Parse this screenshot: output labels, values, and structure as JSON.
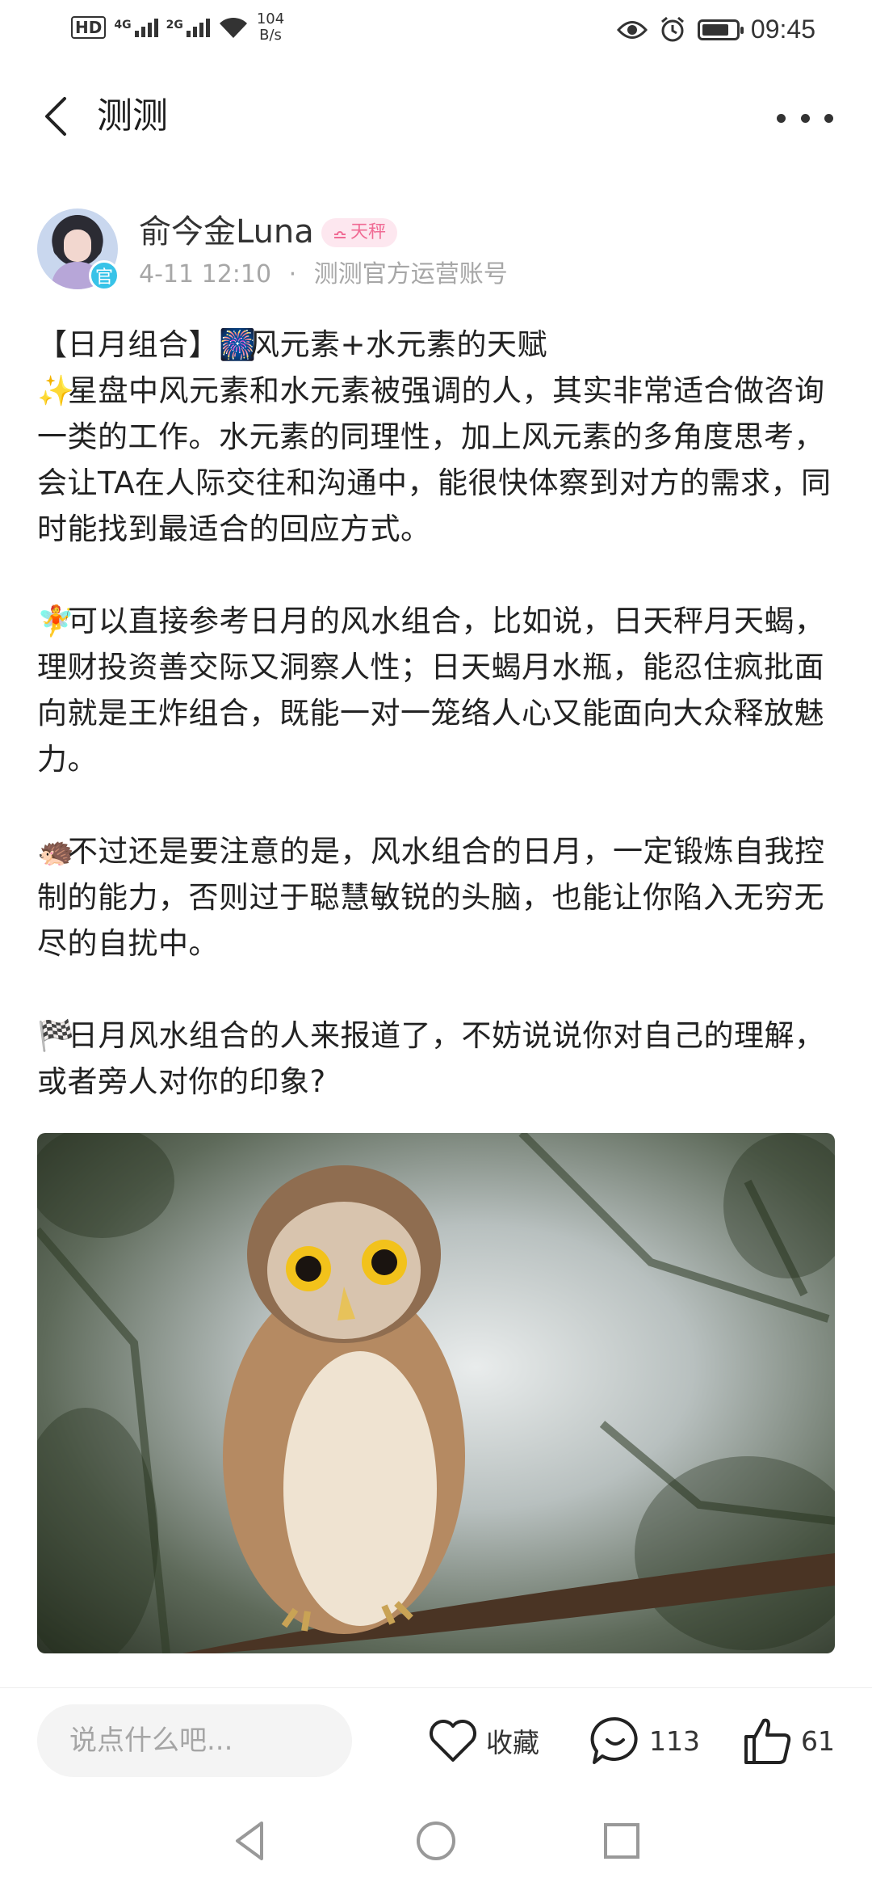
{
  "status_bar": {
    "left": {
      "hd": "HD",
      "sim1": "4G",
      "sim2": "2G",
      "speed_value": "104",
      "speed_unit": "B/s"
    },
    "time": "09:45",
    "battery_level_percent": 80
  },
  "nav": {
    "title": "测测",
    "back_icon": "chevron-left-icon",
    "more_icon": "more-dots-icon"
  },
  "author": {
    "name": "俞今金Luna",
    "official_badge": "官",
    "zodiac_tag": "天秤",
    "zodiac_icon": "libra-icon",
    "time": "4-11 12:10",
    "separator": "·",
    "account_desc": "测测官方运营账号"
  },
  "post": {
    "title": {
      "prefix": "【日月组合】",
      "emoji": "🎆",
      "text": "风元素+水元素的天赋"
    },
    "p1": {
      "emoji": "✨",
      "text": "星盘中风元素和水元素被强调的人，其实非常适合做咨询一类的工作。水元素的同理性，加上风元素的多角度思考，会让TA在人际交往和沟通中，能很快体察到对方的需求，同时能找到最适合的回应方式。"
    },
    "p2": {
      "emoji": "🧚",
      "text": "可以直接参考日月的风水组合，比如说，日天秤月天蝎，理财投资善交际又洞察人性；日天蝎月水瓶，能忍住疯批面向就是王炸组合，既能一对一笼络人心又能面向大众释放魅力。"
    },
    "p3": {
      "emoji": "🦔",
      "text": "不过还是要注意的是，风水组合的日月，一定锻炼自我控制的能力，否则过于聪慧敏锐的头脑，也能让你陷入无穷无尽的自扰中。"
    },
    "p4": {
      "emoji": "🏁",
      "text": "日月风水组合的人来报道了，不妨说说你对自己的理解，或者旁人对你的印象?"
    }
  },
  "image": {
    "subject": "owl-photo"
  },
  "bottom_bar": {
    "comment_placeholder": "说点什么吧...",
    "favorite_label": "收藏",
    "comment_count": "113",
    "like_count": "61"
  },
  "colors": {
    "zodiac_bg": "#fde7ef",
    "zodiac_text": "#f06b94",
    "official_badge": "#38c3e8",
    "meta_text": "#a7a7a7"
  }
}
